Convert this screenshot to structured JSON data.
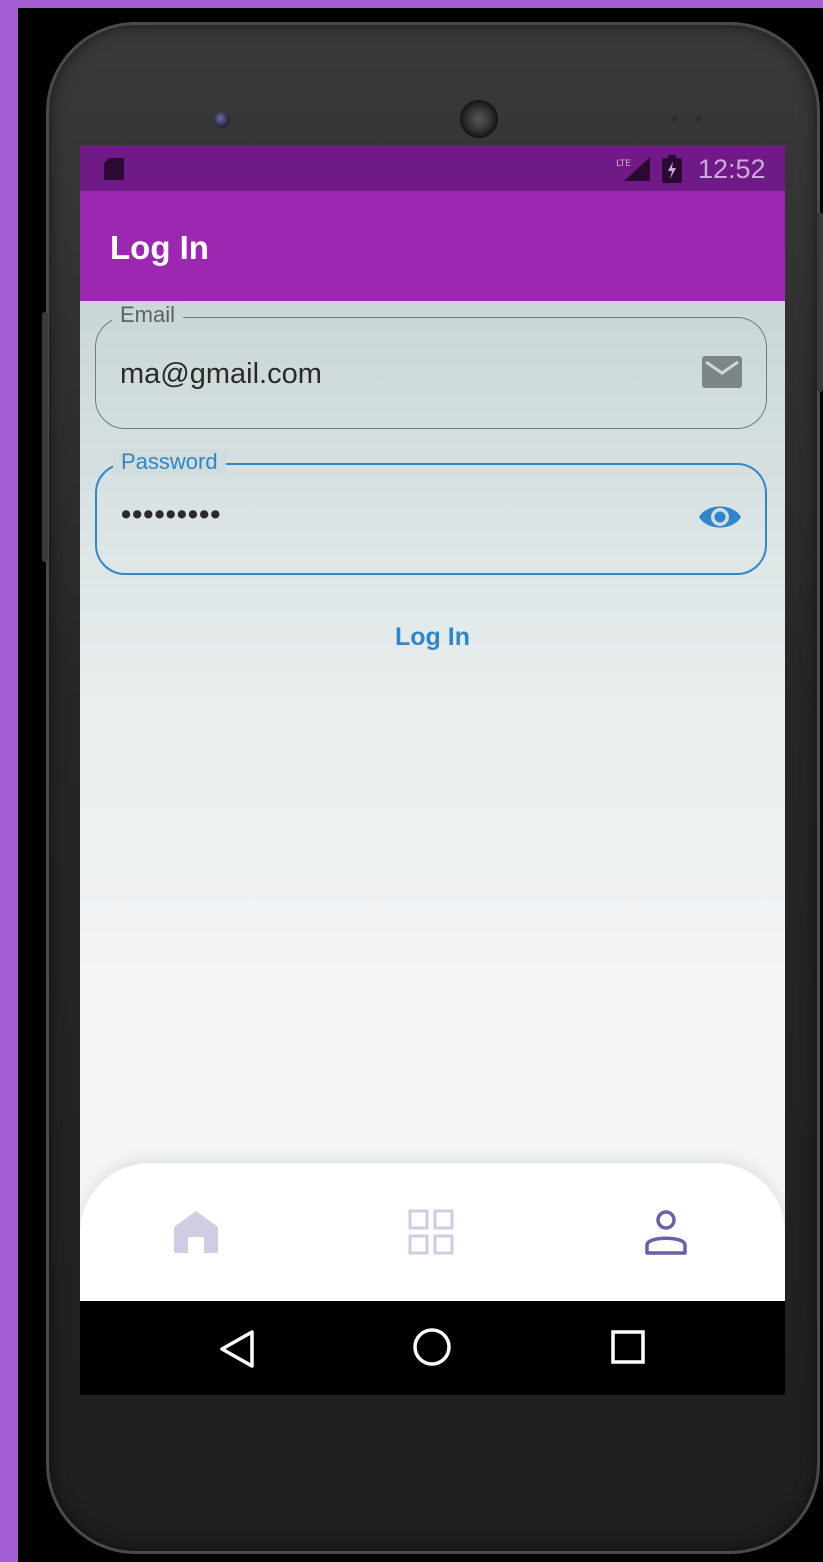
{
  "status_bar": {
    "time": "12:52",
    "icons": [
      "sd-card-icon",
      "lte-signal-icon",
      "battery-icon"
    ]
  },
  "app_bar": {
    "title": "Log In"
  },
  "form": {
    "email": {
      "label": "Email",
      "value": "ma@gmail.com",
      "icon": "mail-icon"
    },
    "password": {
      "label": "Password",
      "value": "•••••••••",
      "icon": "eye-icon",
      "focused": true
    },
    "login_button": "Log In"
  },
  "bottom_nav": {
    "items": [
      {
        "name": "home",
        "icon": "home-icon",
        "active": false
      },
      {
        "name": "grid",
        "icon": "grid-icon",
        "active": false
      },
      {
        "name": "profile",
        "icon": "profile-icon",
        "active": true
      }
    ]
  },
  "system_nav": {
    "icons": [
      "back-icon",
      "home-circle-icon",
      "recents-icon"
    ]
  },
  "colors": {
    "status_bar": "#6f1a86",
    "app_bar": "#9c27b0",
    "accent": "#2f86c9",
    "nav_inactive": "#cfcde3",
    "nav_active": "#6b5fa6"
  }
}
